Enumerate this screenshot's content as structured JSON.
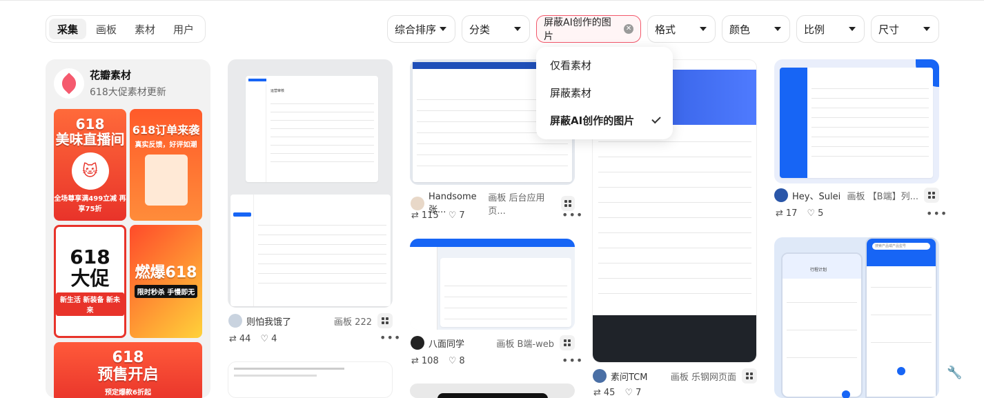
{
  "tabs": [
    {
      "label": "采集",
      "active": true
    },
    {
      "label": "画板",
      "active": false
    },
    {
      "label": "素材",
      "active": false
    },
    {
      "label": "用户",
      "active": false
    }
  ],
  "filters": {
    "sort": "综合排序",
    "category": "分类",
    "ai_filter": "屏蔽AI创作的图片",
    "format": "格式",
    "color": "颜色",
    "ratio": "比例",
    "size": "尺寸"
  },
  "ai_menu": {
    "items": [
      {
        "label": "仅看素材",
        "selected": false
      },
      {
        "label": "屏蔽素材",
        "selected": false
      },
      {
        "label": "屏蔽AI创作的图片",
        "selected": true
      }
    ]
  },
  "brand_card": {
    "name": "花瓣素材",
    "subtitle": "618大促素材更新",
    "posters": [
      {
        "title": "618\n美味直播间",
        "sub": "全场尊享满499立减 再享75折"
      },
      {
        "title": "618订单来袭",
        "sub": "真实反馈，好评如潮"
      },
      {
        "title": "618\n大促",
        "sub": "新生活 新装备 新未来"
      },
      {
        "title": "燃爆618",
        "sub": "限时秒杀 手慢即无"
      },
      {
        "title": "618\n预售开启",
        "sub": "预定爆款6折起"
      }
    ]
  },
  "pins": [
    {
      "user": "则怕我饿了",
      "board": "画板 222",
      "saves": "44",
      "likes": "4"
    },
    {
      "user": "Handsome张...",
      "board": "画板 后台应用页...",
      "saves": "115",
      "likes": "7"
    },
    {
      "user": "八面同学",
      "board": "画板 B端-web",
      "saves": "108",
      "likes": "8"
    },
    {
      "user": "素问TCM",
      "board": "画板 乐钢网页面",
      "saves": "45",
      "likes": "7"
    },
    {
      "user": "Hey、Sulei",
      "board": "画板 【B端】列...",
      "saves": "17",
      "likes": "5"
    }
  ],
  "mock_text": {
    "table_title": "运营审核",
    "app_title": "行程计划",
    "search_placeholder": "搜索产品或产品型号"
  },
  "colors": {
    "accent_red": "#f2576a",
    "primary_blue": "#1765f5",
    "poster_red": "#e8332a"
  }
}
